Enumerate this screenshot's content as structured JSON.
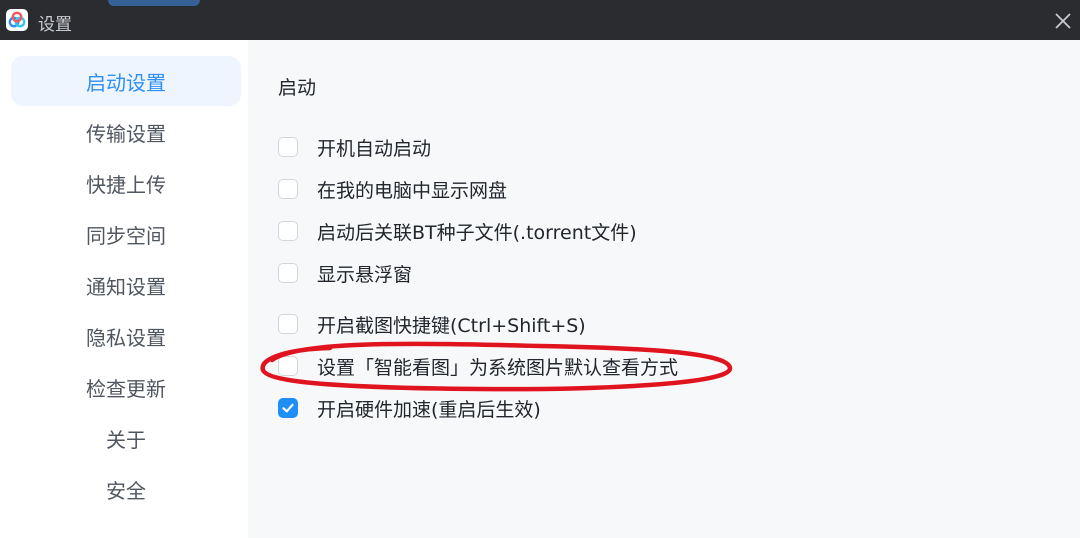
{
  "window": {
    "title": "设置",
    "close_icon": "close-icon",
    "logo_icon": "baidu-netdisk-logo-icon"
  },
  "sidebar": {
    "items": [
      {
        "label": "启动设置",
        "active": true
      },
      {
        "label": "传输设置",
        "active": false
      },
      {
        "label": "快捷上传",
        "active": false
      },
      {
        "label": "同步空间",
        "active": false
      },
      {
        "label": "通知设置",
        "active": false
      },
      {
        "label": "隐私设置",
        "active": false
      },
      {
        "label": "检查更新",
        "active": false
      },
      {
        "label": "关于",
        "active": false
      },
      {
        "label": "安全",
        "active": false
      }
    ]
  },
  "main": {
    "section_title": "启动",
    "options": [
      {
        "label": "开机自动启动",
        "checked": false
      },
      {
        "label": "在我的电脑中显示网盘",
        "checked": false
      },
      {
        "label": "启动后关联BT种子文件(.torrent文件)",
        "checked": false
      },
      {
        "label": "显示悬浮窗",
        "checked": false
      },
      {
        "label": "开启截图快捷键(Ctrl+Shift+S)",
        "checked": false
      },
      {
        "label": "设置「智能看图」为系统图片默认查看方式",
        "checked": false
      },
      {
        "label": "开启硬件加速(重启后生效)",
        "checked": true
      }
    ]
  },
  "colors": {
    "accent": "#1f8ff5",
    "active_bg": "#eef5ff",
    "titlebar": "#2a2c30",
    "annotation": "#e0141e"
  }
}
